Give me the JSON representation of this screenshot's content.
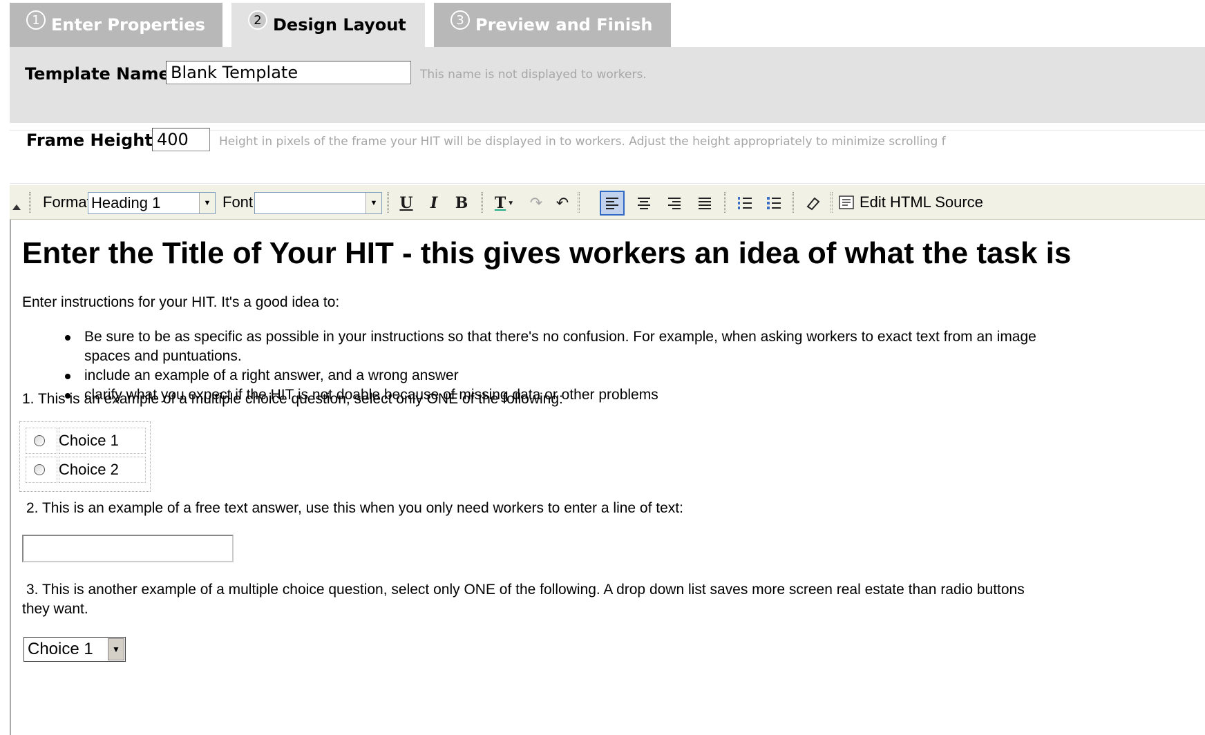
{
  "tabs": [
    {
      "number": "1",
      "label": "Enter Properties",
      "active": false
    },
    {
      "number": "2",
      "label": "Design Layout",
      "active": true
    },
    {
      "number": "3",
      "label": "Preview and Finish",
      "active": false
    }
  ],
  "template_name": {
    "label": "Template Name:",
    "value": "Blank Template",
    "hint": "This name is not displayed to workers."
  },
  "frame_height": {
    "label": "Frame Height",
    "value": "400",
    "hint": "Height in pixels of the frame your HIT will be displayed in to workers. Adjust the height appropriately to minimize scrolling f"
  },
  "toolbar": {
    "format_label": "Format",
    "format_value": "Heading 1",
    "font_label": "Font",
    "font_value": "",
    "underline": "U",
    "italic": "I",
    "bold": "B",
    "text_color": "T",
    "edit_html_label": "Edit HTML Source"
  },
  "editor": {
    "title": "Enter the Title of Your HIT - this gives workers an idea of what the task is",
    "intro": "Enter instructions for your HIT.  It's a good idea to:",
    "bullets": [
      {
        "line1": "Be sure to be as specific as possible in your instructions so that there's no confusion.  For example, when asking workers to exact text from an image",
        "line2": "spaces and puntuations."
      },
      {
        "line1": "include an example of a right answer, and a wrong answer",
        "line2": ""
      },
      {
        "line1": "clarify what you expect if the HIT is not doable because of missing data or other problems",
        "line2": ""
      }
    ],
    "q1": "1. This is an example of a multiple choice question, select only ONE of the following:",
    "choices": [
      "Choice 1",
      "Choice 2"
    ],
    "q2": "2. This is an example of a free text answer, use this when you only need workers to enter a line of text:",
    "q3_line1": "3. This is another example of a multiple choice question, select only ONE of the following.  A drop down list saves more screen real estate than radio buttons",
    "q3_line2": "they want.",
    "dropdown_value": "Choice 1"
  }
}
